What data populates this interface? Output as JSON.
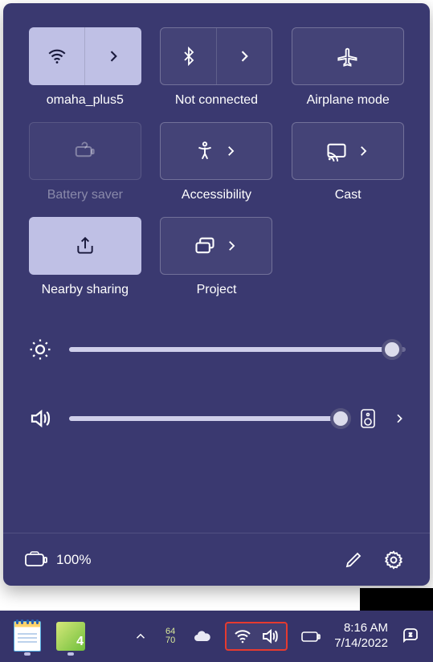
{
  "panel": {
    "tiles": [
      {
        "id": "wifi",
        "label": "omaha_plus5",
        "state": "active",
        "split": true
      },
      {
        "id": "bluetooth",
        "label": "Not connected",
        "state": "inactive",
        "split": true
      },
      {
        "id": "airplane",
        "label": "Airplane mode",
        "state": "inactive",
        "split": false
      },
      {
        "id": "batterysaver",
        "label": "Battery saver",
        "state": "disabled",
        "split": false
      },
      {
        "id": "accessibility",
        "label": "Accessibility",
        "state": "inactive",
        "split": true,
        "single_row": true
      },
      {
        "id": "cast",
        "label": "Cast",
        "state": "inactive",
        "split": true,
        "single_row": true
      },
      {
        "id": "nearby",
        "label": "Nearby sharing",
        "state": "active",
        "split": false
      },
      {
        "id": "project",
        "label": "Project",
        "state": "inactive",
        "split": true,
        "single_row": true
      }
    ],
    "brightness_pct": 96,
    "volume_pct": 99,
    "battery_text": "100%"
  },
  "taskbar": {
    "weather_top": "64",
    "weather_bottom": "70",
    "time": "8:16 AM",
    "date": "7/14/2022",
    "photo_badge": "4"
  }
}
